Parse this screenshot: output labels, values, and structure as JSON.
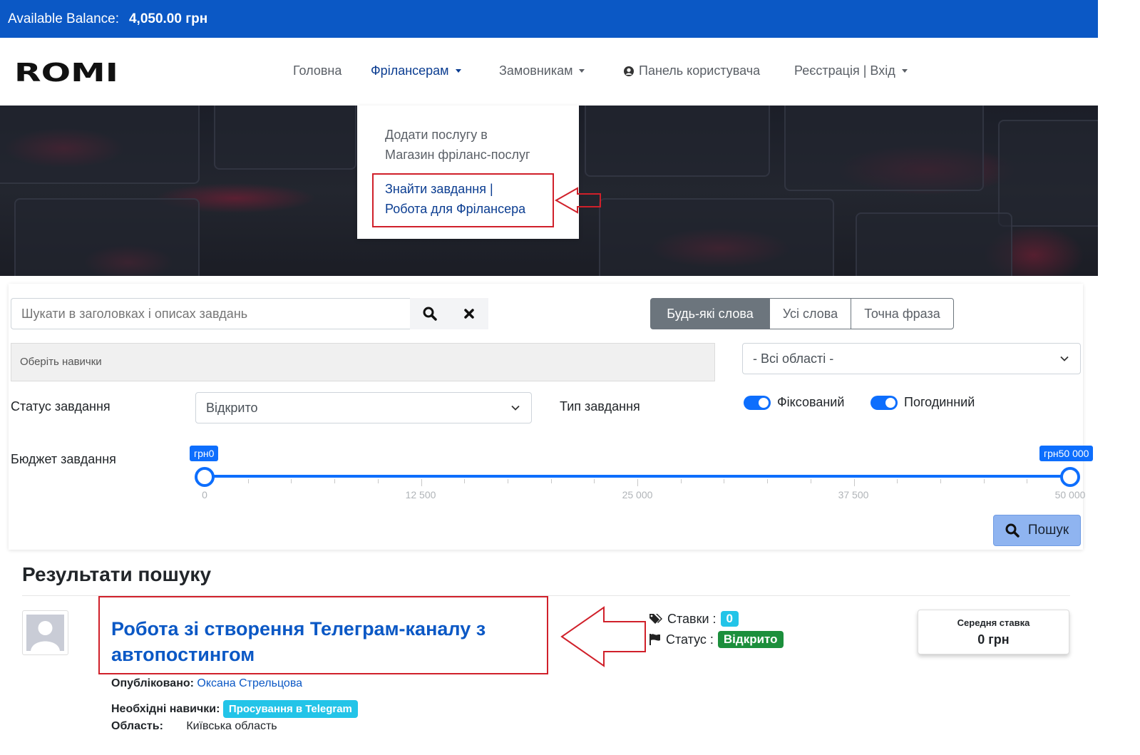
{
  "balance": {
    "label": "Available Balance:",
    "amount": "4,050.00 грн"
  },
  "nav": {
    "home": "Головна",
    "freelancers": "Фрілансерам",
    "clients": "Замовникам",
    "dashboard": "Панель користувача",
    "auth": "Реєстрація | Вхід"
  },
  "dropdown": {
    "item1": "Додати послугу в",
    "item2": "Магазин фріланс-послуг",
    "item3": "Знайти завдання |",
    "item4": "Робота для Фрілансера"
  },
  "search": {
    "placeholder": "Шукати в заголовках і описах завдань",
    "modes": [
      "Будь-які слова",
      "Усі слова",
      "Точна фраза"
    ],
    "active_mode": "Будь-які слова",
    "skills_placeholder": "Оберіть навички",
    "region": "- Всі області -",
    "status_label": "Статус завдання",
    "status_value": "Відкрито",
    "type_label": "Тип завдання",
    "type_fixed": "Фіксований",
    "type_hourly": "Погодинний",
    "budget_label": "Бюджет завдання",
    "budget_min_label": "грн0",
    "budget_max_label": "грн50 000",
    "budget_min": 0,
    "budget_max": 50000,
    "ticks": [
      "0",
      "12 500",
      "25 000",
      "37 500",
      "50 000"
    ],
    "search_button": "Пошук"
  },
  "results": {
    "title": "Результати пошуку",
    "job": {
      "title": "Робота зі створення Телеграм-каналу з автопостингом",
      "published_label": "Опубліковано:",
      "author": "Оксана Стрельцова",
      "skills_label": "Необхідні навички:",
      "skill": "Просування в Telegram",
      "region_label": "Область:",
      "region": "Київська область",
      "bids_label": "Ставки :",
      "bids": "0",
      "status_label": "Статус :",
      "status": "Відкрито",
      "avg_label": "Середня ставка",
      "avg_value": "0 грн"
    }
  },
  "colors": {
    "brand": "#0b58c5",
    "annotation": "#d0202a",
    "toggle": "#0d6efd",
    "status_open": "#1c8f3c",
    "skill_badge": "#23c4e8"
  }
}
